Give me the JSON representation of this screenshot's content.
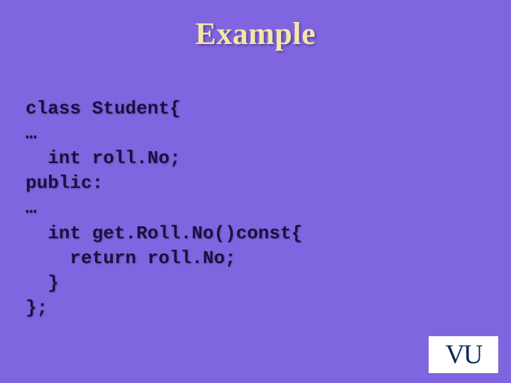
{
  "slide": {
    "title": "Example",
    "code_lines": [
      "class Student{",
      "…",
      "  int roll.No;",
      "public:",
      "…",
      "  int get.Roll.No()const{",
      "    return roll.No;",
      "  }",
      "};"
    ]
  },
  "logo": {
    "text": "VU"
  }
}
